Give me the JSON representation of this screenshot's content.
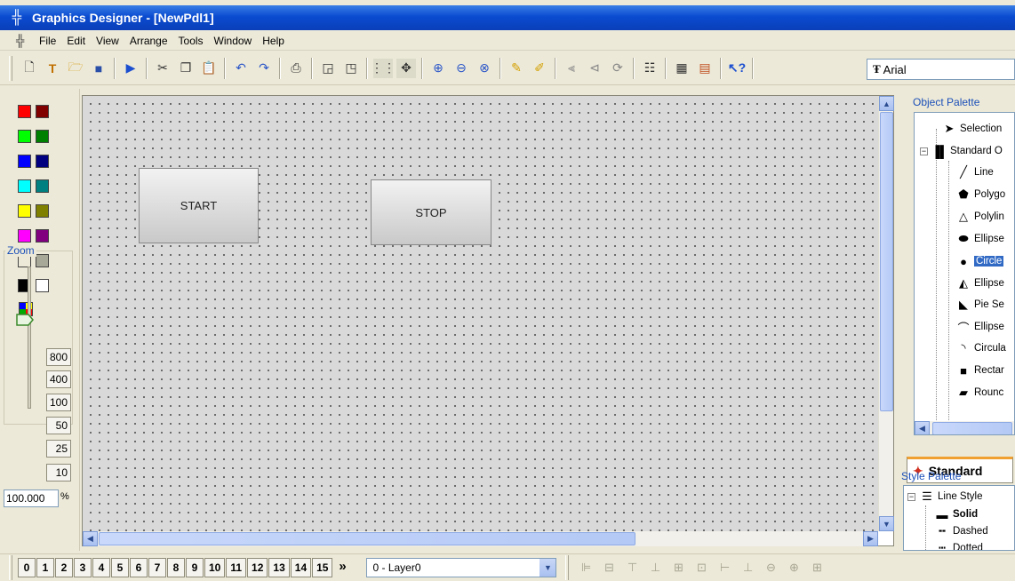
{
  "window": {
    "title": "Graphics Designer - [NewPdl1]",
    "app_icon": "graphics-designer-icon"
  },
  "menu": [
    "File",
    "Edit",
    "View",
    "Arrange",
    "Tools",
    "Window",
    "Help"
  ],
  "toolbar": {
    "font_name": "Arial",
    "icons": [
      "new-document-icon",
      "new-type-icon",
      "open-folder-icon",
      "save-icon",
      "run-icon",
      "cut-icon",
      "copy-icon",
      "paste-icon",
      "undo-icon",
      "redo-icon",
      "print-icon",
      "bring-front-icon",
      "send-back-icon",
      "grid-icon",
      "snap-icon",
      "zoom-in-icon",
      "zoom-out-icon",
      "zoom-fit-icon",
      "group-icon",
      "ungroup-icon",
      "flip-horizontal-icon",
      "flip-vertical-icon",
      "rotate-icon",
      "properties-icon",
      "object-list-icon",
      "layers-icon",
      "help-cursor-icon"
    ]
  },
  "color_palette": [
    "#ff0000",
    "#800000",
    "#00ff00",
    "#008000",
    "#0000ff",
    "#000080",
    "#00ffff",
    "#008080",
    "#ffff00",
    "#808000",
    "#ff00ff",
    "#800080",
    "#ece9d8",
    "#a8a899",
    "#000000",
    "#ffffff"
  ],
  "zoom": {
    "label": "Zoom",
    "levels": [
      "800",
      "400",
      "100",
      "50",
      "25",
      "10"
    ],
    "current": "100.000",
    "percent_symbol": "%"
  },
  "canvas": {
    "objects": [
      {
        "label": "START"
      },
      {
        "label": "STOP"
      }
    ]
  },
  "object_palette": {
    "title": "Object Palette",
    "items": [
      {
        "label": "Selection",
        "icon": "arrow-cursor-icon"
      },
      {
        "label": "Standard O",
        "icon": "standard-objects-icon"
      },
      {
        "label": "Line",
        "icon": "line-icon"
      },
      {
        "label": "Polygo",
        "icon": "polygon-icon"
      },
      {
        "label": "Polylin",
        "icon": "polyline-icon"
      },
      {
        "label": "Ellipse",
        "icon": "ellipse-icon"
      },
      {
        "label": "Circle",
        "icon": "circle-icon"
      },
      {
        "label": "Ellipse",
        "icon": "ellipse-segment-icon"
      },
      {
        "label": "Pie Se",
        "icon": "pie-segment-icon"
      },
      {
        "label": "Ellipse",
        "icon": "ellipse-arc-icon"
      },
      {
        "label": "Circula",
        "icon": "circular-arc-icon"
      },
      {
        "label": "Rectar",
        "icon": "rectangle-icon"
      },
      {
        "label": "Rounc",
        "icon": "rounded-rectangle-icon"
      }
    ],
    "selected_index": 6,
    "tab_label": "Standard"
  },
  "style_palette": {
    "title": "Style Palette",
    "items": [
      {
        "label": "Line Style",
        "icon": "line-style-icon"
      },
      {
        "label": "Solid",
        "icon": "solid-line-icon"
      },
      {
        "label": "Dashed",
        "icon": "dashed-line-icon"
      },
      {
        "label": "Dotted",
        "icon": "dotted-line-icon"
      }
    ]
  },
  "layers": {
    "buttons": [
      "0",
      "1",
      "2",
      "3",
      "4",
      "5",
      "6",
      "7",
      "8",
      "9",
      "10",
      "11",
      "12",
      "13",
      "14",
      "15"
    ],
    "more": "»",
    "selected": "0 - Layer0"
  }
}
